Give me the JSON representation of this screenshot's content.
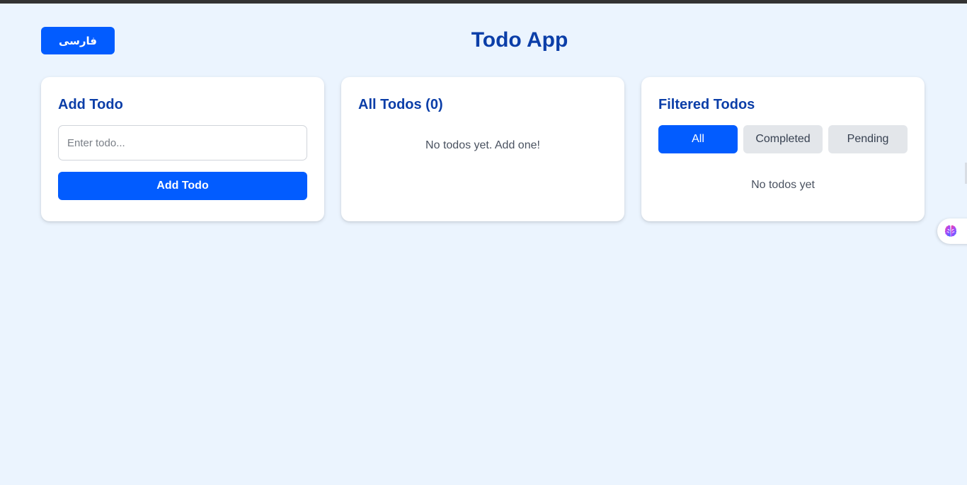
{
  "header": {
    "language_button": "فارسی",
    "title": "Todo App"
  },
  "add_card": {
    "title": "Add Todo",
    "input_placeholder": "Enter todo...",
    "input_value": "",
    "button_label": "Add Todo"
  },
  "all_card": {
    "title": "All Todos (0)",
    "empty_text": "No todos yet. Add one!"
  },
  "filter_card": {
    "title": "Filtered Todos",
    "filters": [
      {
        "label": "All",
        "active": true
      },
      {
        "label": "Completed",
        "active": false
      },
      {
        "label": "Pending",
        "active": false
      }
    ],
    "empty_text": "No todos yet"
  },
  "side_widget": {
    "icon": "brain-icon"
  },
  "colors": {
    "accent": "#025cff",
    "title": "#0b3ea8",
    "background": "#ebf4fe",
    "inactive_filter": "#e3e6ea"
  }
}
